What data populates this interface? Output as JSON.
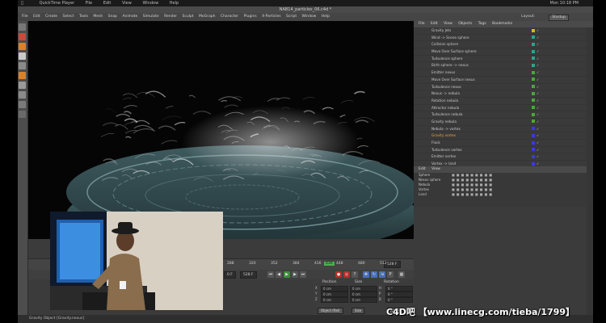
{
  "mac_menubar": {
    "apple": "",
    "app": "QuickTime Player",
    "items": [
      "File",
      "Edit",
      "View",
      "Window",
      "Help"
    ],
    "right": "Mon 10:18 PM"
  },
  "window_title": "NAB14_particles_06.c4d *",
  "menubar": {
    "items": [
      "File",
      "Edit",
      "Create",
      "Select",
      "Tools",
      "Mesh",
      "Snap",
      "Animate",
      "Simulate",
      "Render",
      "Sculpt",
      "MoGraph",
      "Character",
      "Plugins",
      "X-Particles",
      "Script",
      "Window",
      "Help"
    ],
    "layout_label": "Layout:",
    "layout_value": "Startup"
  },
  "object_manager": {
    "tabs": [
      "File",
      "Edit",
      "View",
      "Objects",
      "Tags",
      "Bookmarks"
    ],
    "rows": [
      {
        "name": "Gravity Jets",
        "color": "#d9b52a",
        "highlight": false
      },
      {
        "name": "Wind -> Scene sphere",
        "color": "#2aa58c",
        "highlight": false
      },
      {
        "name": "Collision sphere",
        "color": "#2aa58c",
        "highlight": false
      },
      {
        "name": "Move Over Surface sphere",
        "color": "#2aa58c",
        "highlight": false
      },
      {
        "name": "Turbulence sphere",
        "color": "#2aa58c",
        "highlight": false
      },
      {
        "name": "Birth sphere -> nexus",
        "color": "#2aa58c",
        "highlight": false
      },
      {
        "name": "Emitter nexus",
        "color": "#4aa83a",
        "highlight": false
      },
      {
        "name": "Move Over Surface nexus",
        "color": "#4aa83a",
        "highlight": false
      },
      {
        "name": "Turbulence nexus",
        "color": "#4aa83a",
        "highlight": false
      },
      {
        "name": "Nexus -> nebula",
        "color": "#4aa83a",
        "highlight": false
      },
      {
        "name": "Rotation nebula",
        "color": "#4aa83a",
        "highlight": false
      },
      {
        "name": "Attractor nebula",
        "color": "#4aa83a",
        "highlight": false
      },
      {
        "name": "Turbulence nebula",
        "color": "#4aa83a",
        "highlight": false
      },
      {
        "name": "Gravity nebula",
        "color": "#4aa83a",
        "highlight": false
      },
      {
        "name": "Nebula -> vortex",
        "color": "#3b3bd6",
        "highlight": false
      },
      {
        "name": "Gravity vortex",
        "color": "#3b3bd6",
        "highlight": true
      },
      {
        "name": "Flock",
        "color": "#3b3bd6",
        "highlight": false
      },
      {
        "name": "Turbulence vortex",
        "color": "#3b3bd6",
        "highlight": false
      },
      {
        "name": "Emitter vortex",
        "color": "#3b3bd6",
        "highlight": false
      },
      {
        "name": "Vortex -> land",
        "color": "#3b3bd6",
        "highlight": false
      },
      {
        "name": "Gravity land",
        "color": "#3b3bd6",
        "highlight": false
      },
      {
        "name": "systems",
        "color": "#9a9a9a",
        "highlight": false
      },
      {
        "name": "Scene",
        "color": "#9a9a9a",
        "highlight": false
      }
    ]
  },
  "attributes": {
    "tabs": [
      "Edit",
      "View"
    ],
    "layers": [
      {
        "name": "Sphere"
      },
      {
        "name": "Nexus sphere"
      },
      {
        "name": "Nebula"
      },
      {
        "name": "Vortex"
      },
      {
        "name": "Land"
      }
    ]
  },
  "timeline": {
    "ticks": [
      "288",
      "320",
      "352",
      "384",
      "416",
      "448",
      "480",
      "512"
    ],
    "current_frame": "430",
    "end_field": "528 F"
  },
  "transport": {
    "start_field": "0 F",
    "end_field": "528 F"
  },
  "coordinates": {
    "headers": [
      "Position",
      "Size",
      "Rotation"
    ],
    "rows": [
      {
        "axis": "X",
        "pos": "0 cm",
        "size": "0 cm",
        "rot_axis": "H",
        "rot": "0 °"
      },
      {
        "axis": "Y",
        "pos": "0 cm",
        "size": "0 cm",
        "rot_axis": "P",
        "rot": "0 °"
      },
      {
        "axis": "Z",
        "pos": "0 cm",
        "size": "0 cm",
        "rot_axis": "B",
        "rot": "0 °"
      }
    ],
    "mode": "Object (Rel)",
    "size_mode": "Size",
    "apply": "Apply"
  },
  "status": "Gravity Object [Gravity.nexus]",
  "watermark": "C4D吧 【www.linecg.com/tieba/1799】",
  "colors": {
    "accent_green": "#4caf50",
    "highlight": "#f0a030"
  }
}
